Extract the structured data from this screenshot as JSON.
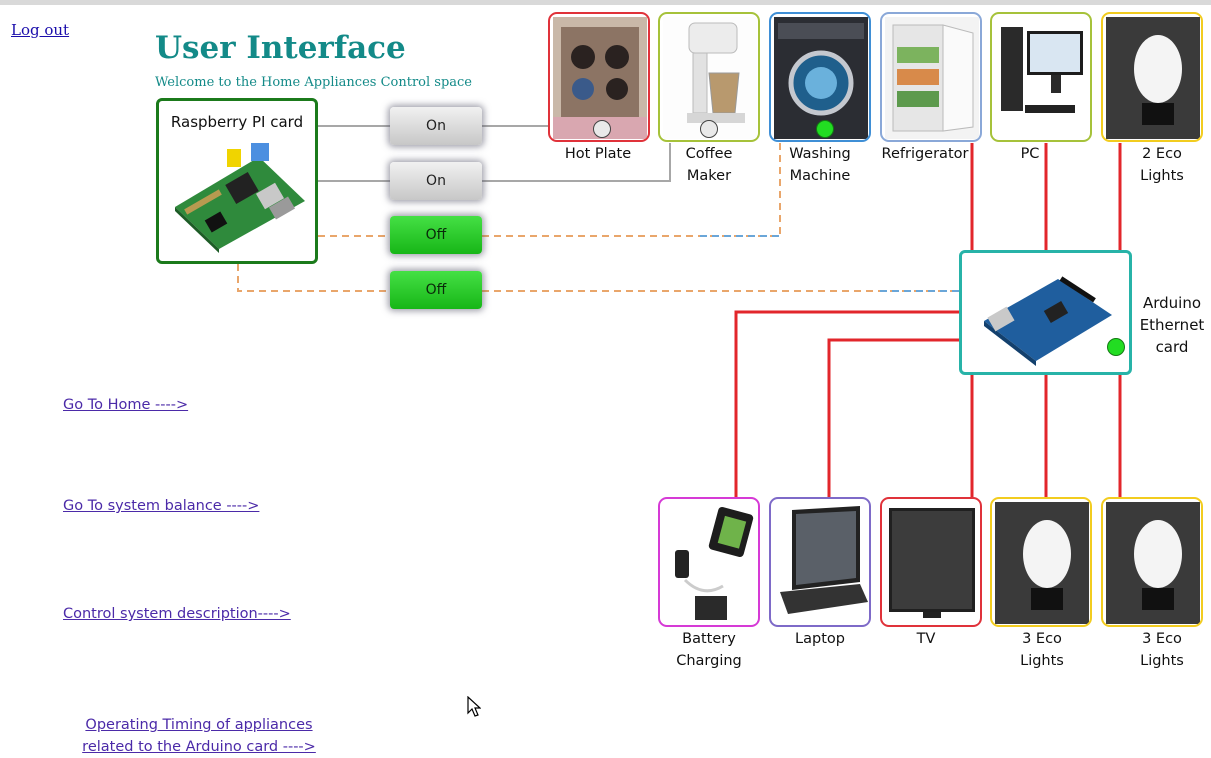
{
  "header": {
    "logout_label": "Log out",
    "title": "User Interface",
    "subtitle": "Welcome to the Home Appliances Control space"
  },
  "controller": {
    "label": "Raspberry PI card",
    "switches": [
      {
        "label": "On",
        "state": "on",
        "target": "Hot Plate"
      },
      {
        "label": "On",
        "state": "on",
        "target": "Coffee Maker"
      },
      {
        "label": "Off",
        "state": "off",
        "target": "Washing Machine"
      },
      {
        "label": "Off",
        "state": "off",
        "target": "Arduino Ethernet card"
      }
    ]
  },
  "appliances_top": [
    {
      "name": "Hot Plate",
      "caption_lines": [
        "Hot Plate"
      ],
      "border_color": "#e0323a",
      "indicator": "off"
    },
    {
      "name": "Coffee Maker",
      "caption_lines": [
        "Coffee",
        "Maker"
      ],
      "border_color": "#a6c23a",
      "indicator": "off"
    },
    {
      "name": "Washing Machine",
      "caption_lines": [
        "Washing",
        "Machine"
      ],
      "border_color": "#3f8fd6",
      "indicator": "on"
    },
    {
      "name": "Refrigerator",
      "caption_lines": [
        "Refrigerator"
      ],
      "border_color": "#8aa8d8",
      "indicator": "none"
    },
    {
      "name": "PC",
      "caption_lines": [
        "PC"
      ],
      "border_color": "#a6c23a",
      "indicator": "none"
    },
    {
      "name": "2 Eco Lights",
      "caption_lines": [
        "2 Eco",
        "Lights"
      ],
      "border_color": "#f2cc1f",
      "indicator": "none"
    }
  ],
  "arduino": {
    "caption_lines": [
      "Arduino",
      "Ethernet",
      "card"
    ],
    "indicator": "on"
  },
  "appliances_bottom": [
    {
      "name": "Battery Charging",
      "caption_lines": [
        "Battery",
        "Charging"
      ],
      "border_color": "#d63ad6"
    },
    {
      "name": "Laptop",
      "caption_lines": [
        "Laptop"
      ],
      "border_color": "#7e6ac8"
    },
    {
      "name": "TV",
      "caption_lines": [
        "TV"
      ],
      "border_color": "#e0323a"
    },
    {
      "name": "3 Eco Lights",
      "caption_lines": [
        "3 Eco",
        "Lights"
      ],
      "border_color": "#f2cc1f"
    },
    {
      "name": "3 Eco Lights",
      "caption_lines": [
        "3 Eco",
        "Lights"
      ],
      "border_color": "#f2cc1f"
    }
  ],
  "nav": {
    "home": "Go To Home ---->",
    "balance": "Go To system balance ---->",
    "description": "Control system description---->",
    "timing_line1": "Operating Timing of appliances",
    "timing_line2": "related to the Arduino card ---->"
  },
  "colors": {
    "title": "#138a88",
    "power_line": "#e2262b",
    "wire_gray": "#a7a7a7",
    "dashed_orange": "#e9a66b",
    "dashed_blue": "#6aa6d8",
    "switch_on": "#d6d6d6",
    "switch_off": "#22cc22",
    "indicator_on": "#22dd22",
    "link": "#4b2aa8"
  }
}
